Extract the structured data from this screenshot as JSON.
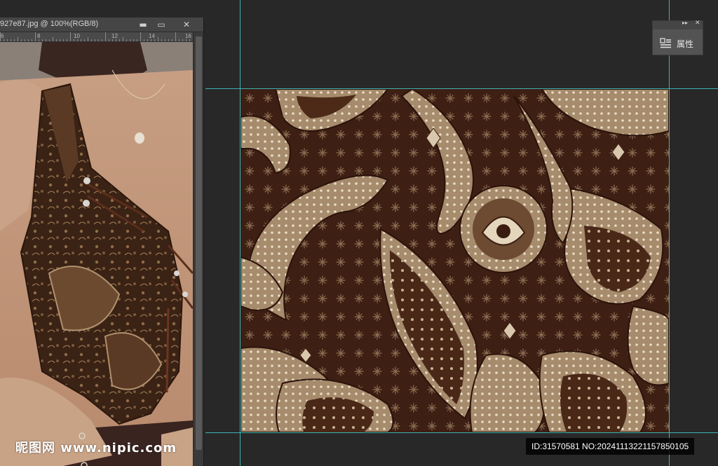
{
  "document_window": {
    "title": "927e87.jpg @ 100%(RGB/8)",
    "ruler_labels": [
      "6",
      "8",
      "10",
      "12",
      "14",
      "16"
    ],
    "minimize_symbol": "▬",
    "maximize_symbol": "▭",
    "close_symbol": "✕"
  },
  "properties_panel": {
    "collapse_symbol": "▸▸",
    "close_symbol": "✕",
    "label": "属性",
    "icon": "properties-icon"
  },
  "watermark": {
    "logo": "昵图网 www.nipic.com",
    "id_text": "ID:31570581 NO:20241113221157850105"
  },
  "colors": {
    "workspace_bg": "#282828",
    "pattern_bg": "#3e1f14",
    "pattern_motif": "#a68b6c",
    "pattern_light": "#e2d2bb",
    "guide": "#3fc9c9",
    "panel_bg": "#535353"
  }
}
